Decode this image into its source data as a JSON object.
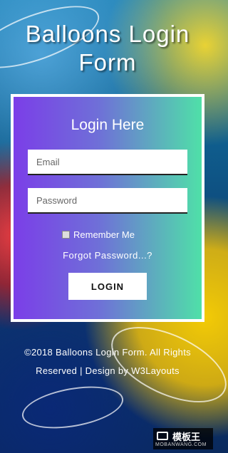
{
  "page": {
    "title": "Balloons Login Form"
  },
  "form": {
    "heading": "Login Here",
    "email_placeholder": "Email",
    "password_placeholder": "Password",
    "remember_label": "Remember Me",
    "forgot_label": "Forgot Password...?",
    "login_label": "LOGIN"
  },
  "footer": {
    "line1": "©2018 Balloons Login Form. All Rights",
    "line2": "Reserved | Design by W3Layouts"
  },
  "watermark": {
    "text": "模板王",
    "sub": "MOBANWANG.COM"
  },
  "colors": {
    "gradient_start": "#7b3ee8",
    "gradient_end": "#4fe0a8"
  }
}
